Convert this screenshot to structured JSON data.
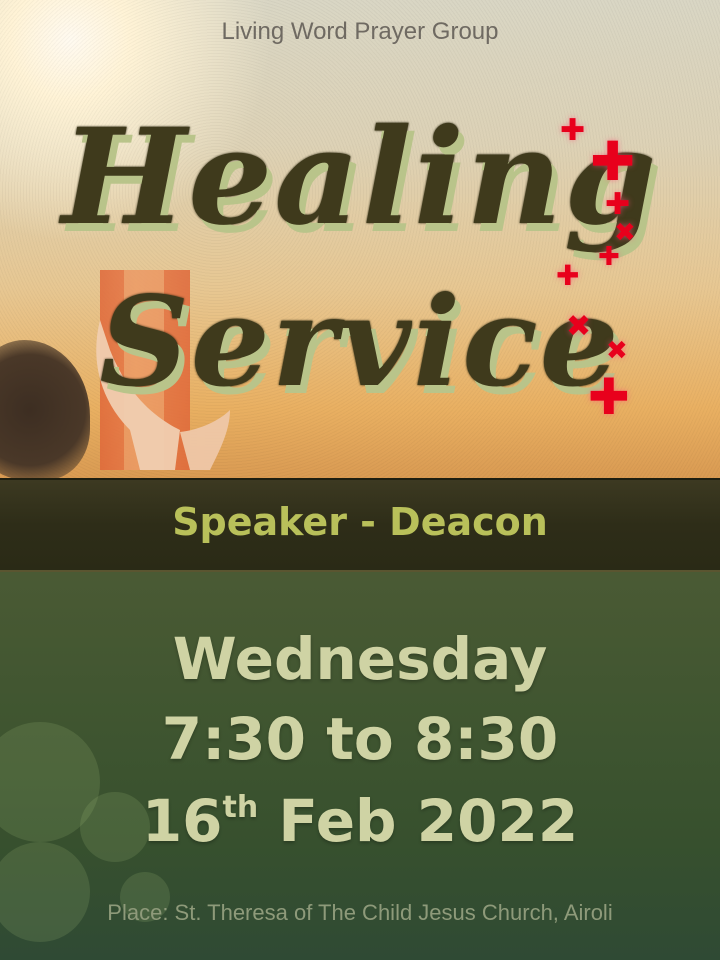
{
  "poster": {
    "group_name": "Living Word Prayer Group",
    "title_line1": "Healing",
    "title_line2": "Service",
    "speaker": "Speaker - Deacon",
    "day": "Wednesday",
    "time": "7:30 to 8:30",
    "date_day": "16",
    "date_suffix": "th",
    "date_rest": " Feb 2022",
    "place": "Place: St. Theresa of The Child Jesus Church, Airoli"
  },
  "colors": {
    "title": "#3f3a1c",
    "title_shadow": "#b9c48a",
    "speaker": "#b9c05a",
    "details": "#cfd3a4",
    "cross": "#e8001c",
    "band": "#2e2d18"
  },
  "icons": [
    "red-cross-icon",
    "praying-hands-image",
    "tree-silhouette"
  ]
}
